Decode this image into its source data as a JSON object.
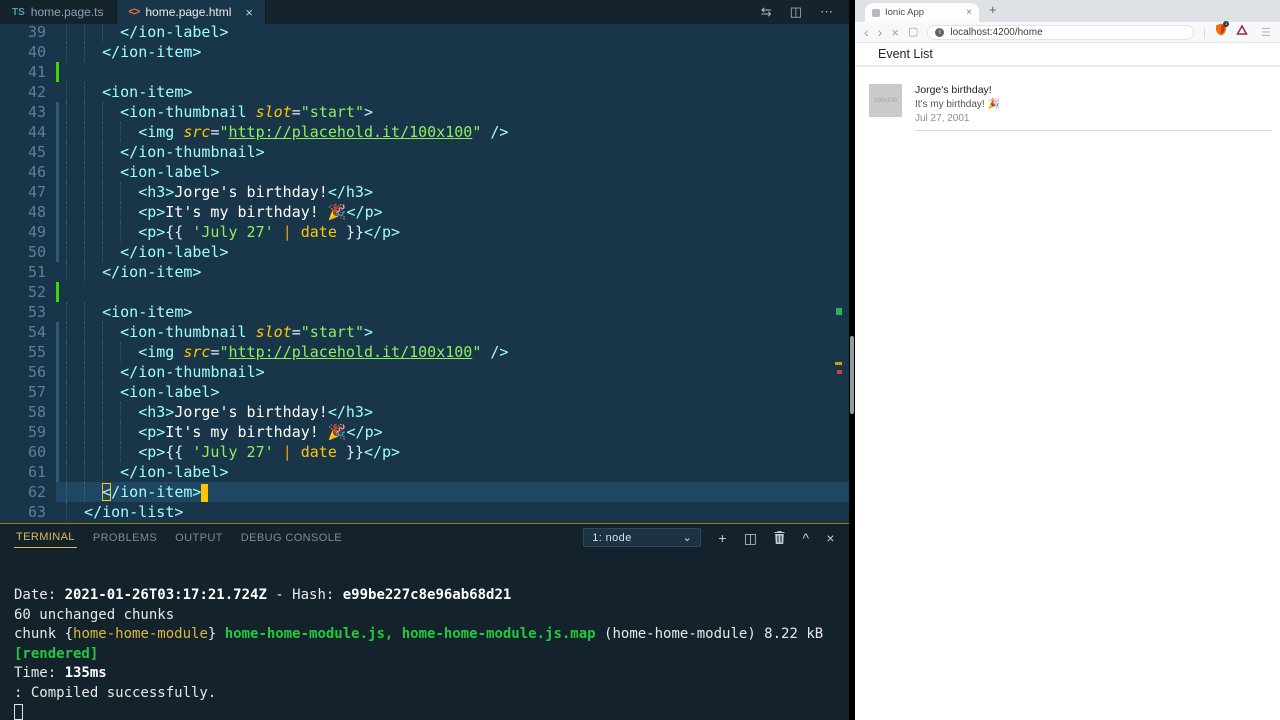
{
  "colors": {
    "editor_bg": "#193549",
    "panel_bg": "#14222c",
    "accent": "#ffc600",
    "tag": "#9effff",
    "string": "#8cf060",
    "attr": "#ffc600",
    "terminal_green": "#21c93d",
    "terminal_yellow": "#d7ba3d"
  },
  "vscode": {
    "tabs": [
      {
        "icon": "TS",
        "label": "home.page.ts"
      },
      {
        "icon": "<>",
        "label": "home.page.html",
        "close": "×"
      }
    ],
    "tab_actions": [
      {
        "name": "open-changes-icon",
        "glyph": "⇆"
      },
      {
        "name": "split-editor-icon",
        "glyph": "◫"
      },
      {
        "name": "more-actions-icon",
        "glyph": "⋯"
      }
    ],
    "editor": {
      "current_line": 62,
      "lines": [
        {
          "n": 39,
          "ind": 6,
          "tk": [
            [
              "t",
              "</ion-label>"
            ]
          ]
        },
        {
          "n": 40,
          "ind": 4,
          "tk": [
            [
              "t",
              "</ion-item>"
            ]
          ]
        },
        {
          "n": 41,
          "ind": 0,
          "g": "a",
          "tk": []
        },
        {
          "n": 42,
          "ind": 4,
          "tk": [
            [
              "t",
              "<ion-item>"
            ]
          ]
        },
        {
          "n": 43,
          "ind": 6,
          "g": "m",
          "tk": [
            [
              "t",
              "<ion-thumbnail"
            ],
            [
              "x",
              " "
            ],
            [
              "a",
              "slot"
            ],
            [
              "p",
              "="
            ],
            [
              "s",
              "\"start\""
            ],
            [
              "t",
              ">"
            ]
          ]
        },
        {
          "n": 44,
          "ind": 8,
          "g": "m",
          "tk": [
            [
              "t",
              "<img"
            ],
            [
              "x",
              " "
            ],
            [
              "a",
              "src"
            ],
            [
              "p",
              "="
            ],
            [
              "s",
              "\""
            ],
            [
              "l",
              "http://placehold.it/100x100"
            ],
            [
              "s",
              "\""
            ],
            [
              "x",
              " "
            ],
            [
              "t",
              "/>"
            ]
          ]
        },
        {
          "n": 45,
          "ind": 6,
          "g": "m",
          "tk": [
            [
              "t",
              "</ion-thumbnail>"
            ]
          ]
        },
        {
          "n": 46,
          "ind": 6,
          "g": "m",
          "tk": [
            [
              "t",
              "<ion-label>"
            ]
          ]
        },
        {
          "n": 47,
          "ind": 8,
          "g": "m",
          "tk": [
            [
              "t",
              "<h3>"
            ],
            [
              "x",
              "Jorge's birthday!"
            ],
            [
              "t",
              "</h3>"
            ]
          ]
        },
        {
          "n": 48,
          "ind": 8,
          "g": "m",
          "tk": [
            [
              "t",
              "<p>"
            ],
            [
              "x",
              "It's my birthday! 🎉"
            ],
            [
              "t",
              "</p>"
            ]
          ]
        },
        {
          "n": 49,
          "ind": 8,
          "g": "m",
          "tk": [
            [
              "t",
              "<p>"
            ],
            [
              "p",
              "{{ "
            ],
            [
              "s",
              "'July 27'"
            ],
            [
              "x",
              " "
            ],
            [
              "o",
              "|"
            ],
            [
              "x",
              " "
            ],
            [
              "f",
              "date"
            ],
            [
              "p",
              " }}"
            ],
            [
              "t",
              "</p>"
            ]
          ]
        },
        {
          "n": 50,
          "ind": 6,
          "g": "m",
          "tk": [
            [
              "t",
              "</ion-label>"
            ]
          ]
        },
        {
          "n": 51,
          "ind": 4,
          "tk": [
            [
              "t",
              "</ion-item>"
            ]
          ]
        },
        {
          "n": 52,
          "ind": 0,
          "g": "a",
          "tk": []
        },
        {
          "n": 53,
          "ind": 4,
          "tk": [
            [
              "t",
              "<ion-item>"
            ]
          ]
        },
        {
          "n": 54,
          "ind": 6,
          "g": "m",
          "tk": [
            [
              "t",
              "<ion-thumbnail"
            ],
            [
              "x",
              " "
            ],
            [
              "a",
              "slot"
            ],
            [
              "p",
              "="
            ],
            [
              "s",
              "\"start\""
            ],
            [
              "t",
              ">"
            ]
          ]
        },
        {
          "n": 55,
          "ind": 8,
          "g": "m",
          "tk": [
            [
              "t",
              "<img"
            ],
            [
              "x",
              " "
            ],
            [
              "a",
              "src"
            ],
            [
              "p",
              "="
            ],
            [
              "s",
              "\""
            ],
            [
              "l",
              "http://placehold.it/100x100"
            ],
            [
              "s",
              "\""
            ],
            [
              "x",
              " "
            ],
            [
              "t",
              "/>"
            ]
          ]
        },
        {
          "n": 56,
          "ind": 6,
          "g": "m",
          "tk": [
            [
              "t",
              "</ion-thumbnail>"
            ]
          ]
        },
        {
          "n": 57,
          "ind": 6,
          "g": "m",
          "tk": [
            [
              "t",
              "<ion-label>"
            ]
          ]
        },
        {
          "n": 58,
          "ind": 8,
          "g": "m",
          "tk": [
            [
              "t",
              "<h3>"
            ],
            [
              "x",
              "Jorge's birthday!"
            ],
            [
              "t",
              "</h3>"
            ]
          ]
        },
        {
          "n": 59,
          "ind": 8,
          "g": "m",
          "tk": [
            [
              "t",
              "<p>"
            ],
            [
              "x",
              "It's my birthday! 🎉"
            ],
            [
              "t",
              "</p>"
            ]
          ]
        },
        {
          "n": 60,
          "ind": 8,
          "g": "m",
          "tk": [
            [
              "t",
              "<p>"
            ],
            [
              "p",
              "{{ "
            ],
            [
              "s",
              "'July 27'"
            ],
            [
              "x",
              " "
            ],
            [
              "o",
              "|"
            ],
            [
              "x",
              " "
            ],
            [
              "f",
              "date"
            ],
            [
              "p",
              " }}"
            ],
            [
              "t",
              "</p>"
            ]
          ]
        },
        {
          "n": 61,
          "ind": 6,
          "g": "m",
          "tk": [
            [
              "t",
              "</ion-label>"
            ]
          ]
        },
        {
          "n": 62,
          "ind": 4,
          "cur": true,
          "tk": [
            [
              "m",
              "<"
            ],
            [
              "t",
              "/ion-item>"
            ]
          ]
        },
        {
          "n": 63,
          "ind": 2,
          "tk": [
            [
              "t",
              "</ion-list>"
            ]
          ]
        }
      ]
    },
    "panel": {
      "tabs": [
        {
          "label": "TERMINAL"
        },
        {
          "label": "PROBLEMS"
        },
        {
          "label": "OUTPUT"
        },
        {
          "label": "DEBUG CONSOLE"
        }
      ],
      "shell_select": "1: node",
      "shell_chevron": "⌄",
      "actions": [
        {
          "name": "new-terminal-icon",
          "glyph": "+"
        },
        {
          "name": "split-terminal-icon",
          "glyph": "◫"
        },
        {
          "name": "kill-terminal-icon",
          "glyph": "trash-svg"
        },
        {
          "name": "maximize-panel-icon",
          "glyph": "^"
        },
        {
          "name": "close-panel-icon",
          "glyph": "×"
        }
      ],
      "terminal_lines": [
        [
          [
            "w",
            "Date: "
          ],
          [
            "b",
            "2021-01-26T03:17:21.724Z"
          ],
          [
            "w",
            " - Hash: "
          ],
          [
            "b",
            "e99be227c8e96ab68d21"
          ]
        ],
        [
          [
            "w",
            "60 unchanged chunks"
          ]
        ],
        [
          [
            "w",
            "chunk {"
          ],
          [
            "y",
            "home-home-module"
          ],
          [
            "w",
            "} "
          ],
          [
            "gb",
            "home-home-module.js, home-home-module.js.map"
          ],
          [
            "w",
            " (home-home-module) 8.22 kB"
          ]
        ],
        [
          [
            "gb",
            "  [rendered]"
          ]
        ],
        [
          [
            "w",
            "Time: "
          ],
          [
            "b",
            "135ms"
          ]
        ],
        [
          [
            "w",
            ": Compiled successfully."
          ]
        ]
      ]
    }
  },
  "browser": {
    "tab_title": "Ionic App",
    "tab_close": "×",
    "new_tab": "+",
    "nav": [
      {
        "name": "back-icon",
        "glyph": "‹"
      },
      {
        "name": "forward-icon",
        "glyph": "›"
      },
      {
        "name": "stop-icon",
        "glyph": "×"
      },
      {
        "name": "bookmark-icon",
        "glyph": "▢"
      }
    ],
    "url": "localhost:4200/home",
    "menu_glyph": "☰",
    "header_title": "Event List",
    "event_item": {
      "thumb_text": "100x100",
      "title": "Jorge's birthday!",
      "subtitle": "It's my birthday! 🎉",
      "date": "Jul 27, 2001"
    }
  }
}
